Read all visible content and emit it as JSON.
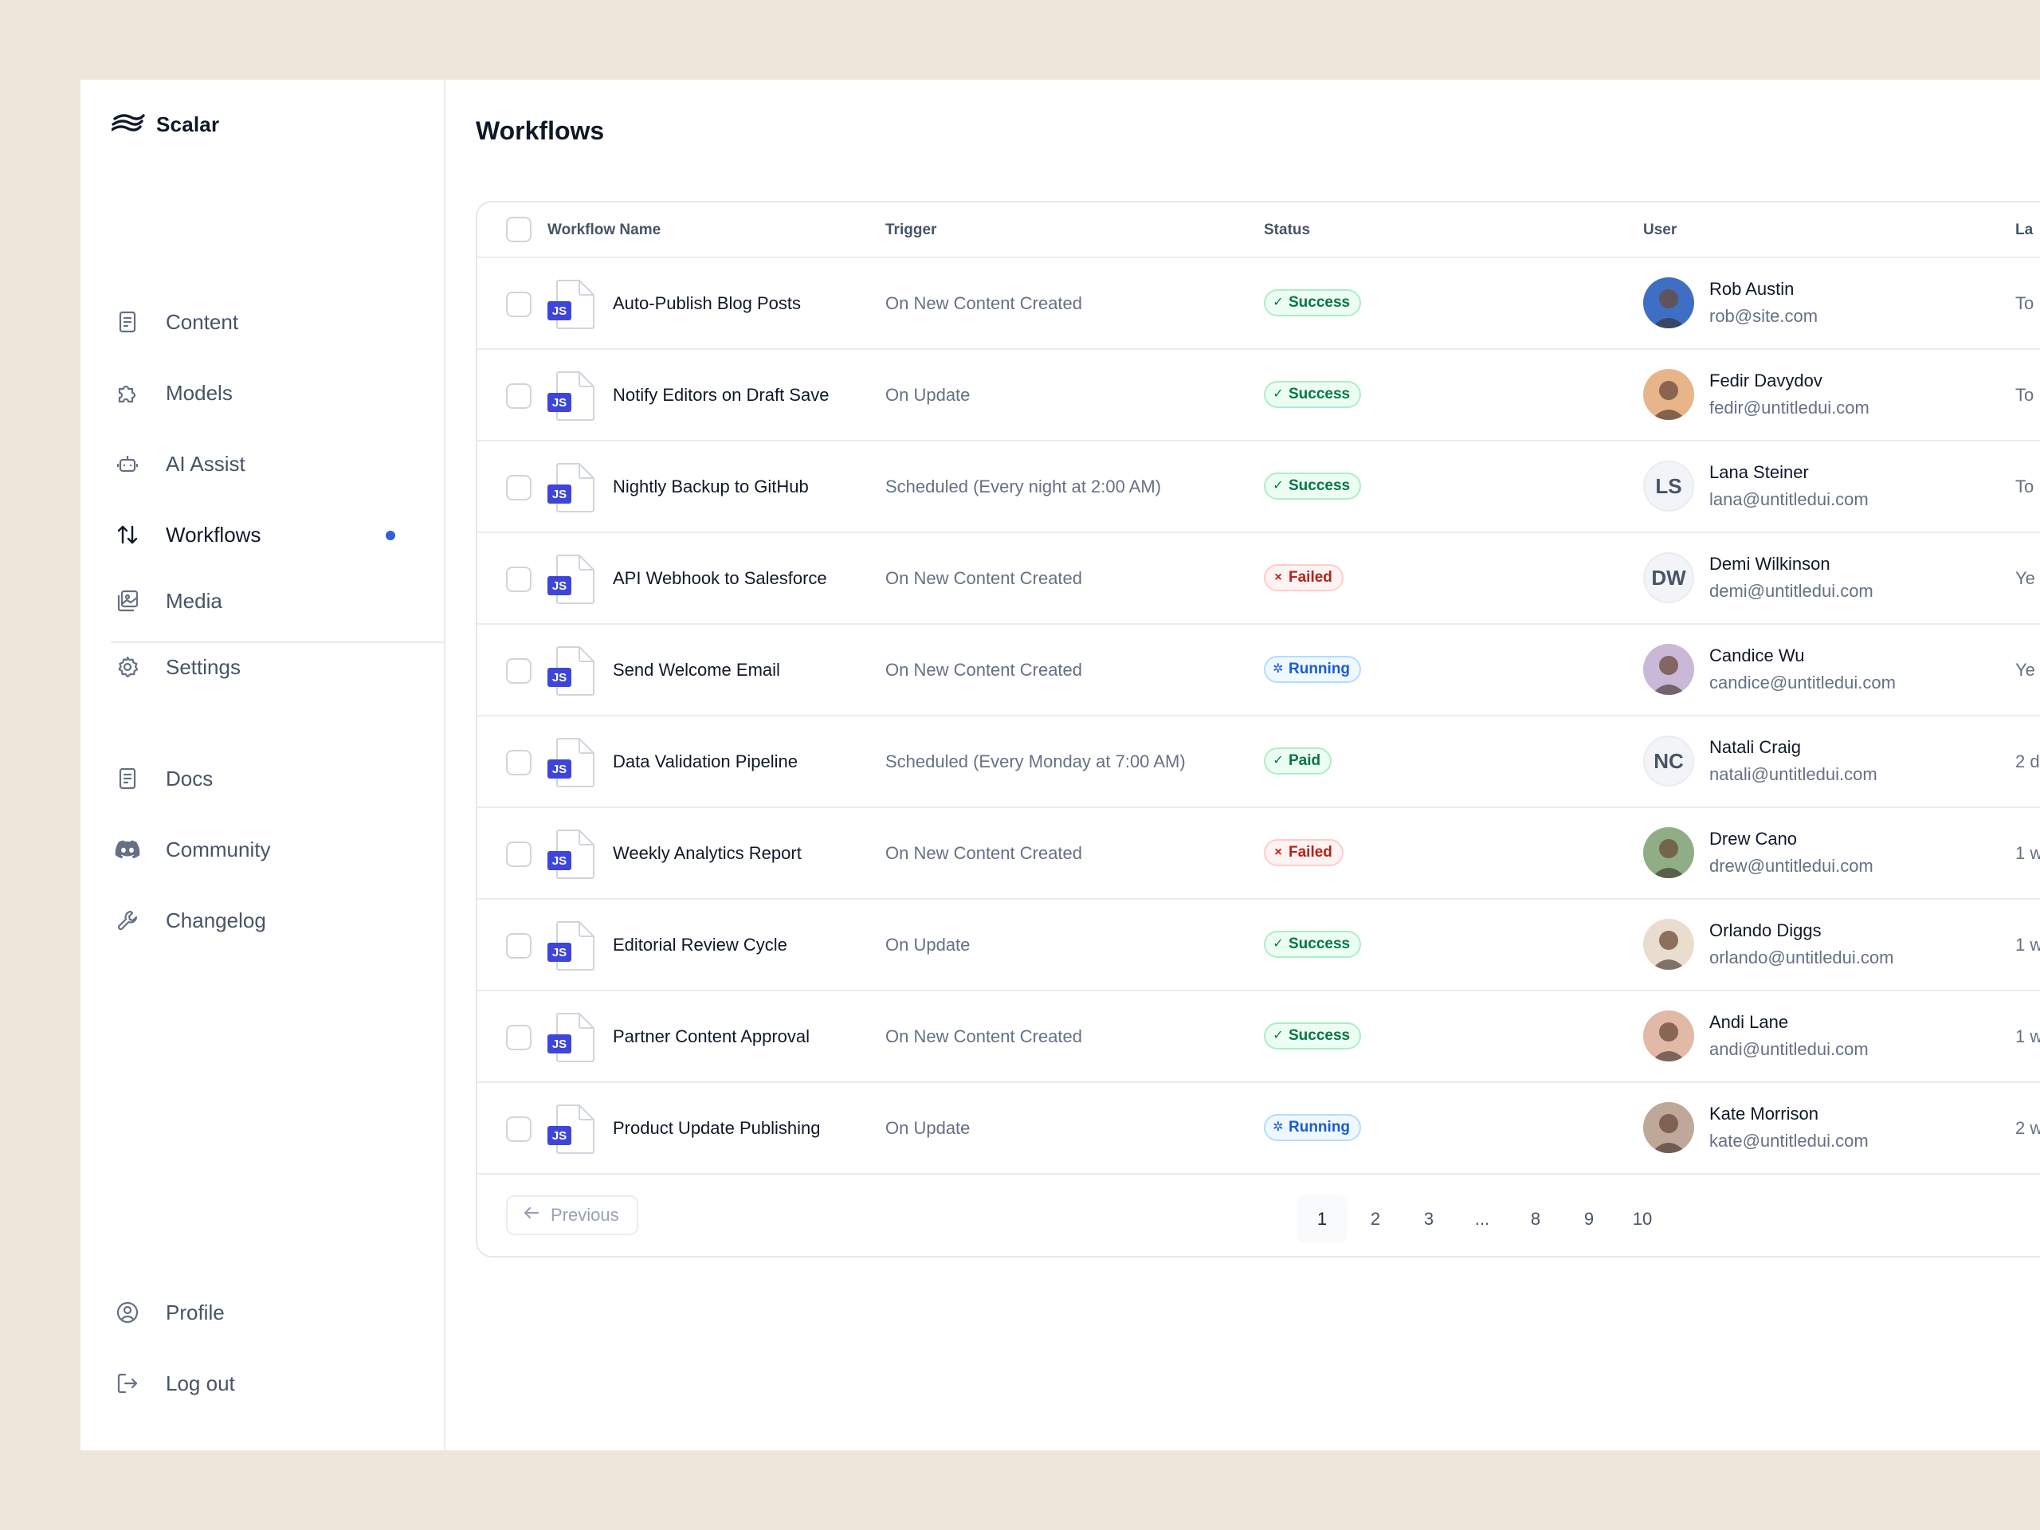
{
  "app": {
    "name": "Scalar"
  },
  "sidebar": {
    "items": [
      {
        "label": "Content",
        "icon": "document-icon"
      },
      {
        "label": "Models",
        "icon": "puzzle-icon"
      },
      {
        "label": "AI Assist",
        "icon": "robot-icon"
      },
      {
        "label": "Workflows",
        "icon": "arrows-up-down-icon",
        "active": true
      },
      {
        "label": "Media",
        "icon": "image-stack-icon"
      },
      {
        "label": "Settings",
        "icon": "gear-icon"
      }
    ],
    "secondary": [
      {
        "label": "Docs",
        "icon": "document-icon"
      },
      {
        "label": "Community",
        "icon": "discord-icon"
      },
      {
        "label": "Changelog",
        "icon": "wrench-icon"
      }
    ],
    "footer": [
      {
        "label": "Profile",
        "icon": "user-circle-icon"
      },
      {
        "label": "Log out",
        "icon": "log-out-icon"
      }
    ]
  },
  "main": {
    "title": "Workflows",
    "columns": [
      "Workflow Name",
      "Trigger",
      "Status",
      "User",
      "La"
    ],
    "file_badge": "JS",
    "rows": [
      {
        "name": "Auto-Publish Blog Posts",
        "trigger": "On New Content Created",
        "status": "Success",
        "status_type": "success",
        "user": "Rob Austin",
        "email": "rob@site.com",
        "avatar": "photo",
        "avatar_color": "#3e6fc4",
        "last": "To"
      },
      {
        "name": "Notify Editors on Draft Save",
        "trigger": "On Update",
        "status": "Success",
        "status_type": "success",
        "user": "Fedir Davydov",
        "email": "fedir@untitledui.com",
        "avatar": "photo",
        "avatar_color": "#e8b48a",
        "last": "To"
      },
      {
        "name": "Nightly Backup to GitHub",
        "trigger": "Scheduled (Every night at 2:00 AM)",
        "status": "Success",
        "status_type": "success",
        "user": "Lana Steiner",
        "email": "lana@untitledui.com",
        "avatar": "LS",
        "last": "To"
      },
      {
        "name": "API Webhook to Salesforce",
        "trigger": "On New Content Created",
        "status": "Failed",
        "status_type": "failed",
        "user": "Demi Wilkinson",
        "email": "demi@untitledui.com",
        "avatar": "DW",
        "last": "Ye"
      },
      {
        "name": "Send Welcome Email",
        "trigger": "On New Content Created",
        "status": "Running",
        "status_type": "running",
        "user": "Candice Wu",
        "email": "candice@untitledui.com",
        "avatar": "photo",
        "avatar_color": "#c9b8d8",
        "last": "Ye"
      },
      {
        "name": "Data Validation Pipeline",
        "trigger": "Scheduled (Every Monday at 7:00 AM)",
        "status": "Paid",
        "status_type": "paid",
        "user": "Natali Craig",
        "email": "natali@untitledui.com",
        "avatar": "NC",
        "last": "2 d"
      },
      {
        "name": "Weekly Analytics Report",
        "trigger": "On New Content Created",
        "status": "Failed",
        "status_type": "failed",
        "user": "Drew Cano",
        "email": "drew@untitledui.com",
        "avatar": "photo",
        "avatar_color": "#8fae86",
        "last": "1 w"
      },
      {
        "name": "Editorial Review Cycle",
        "trigger": "On Update",
        "status": "Success",
        "status_type": "success",
        "user": "Orlando Diggs",
        "email": "orlando@untitledui.com",
        "avatar": "photo",
        "avatar_color": "#e9ddd0",
        "last": "1 w"
      },
      {
        "name": "Partner Content Approval",
        "trigger": "On New Content Created",
        "status": "Success",
        "status_type": "success",
        "user": "Andi Lane",
        "email": "andi@untitledui.com",
        "avatar": "photo",
        "avatar_color": "#e2b9a6",
        "last": "1 w"
      },
      {
        "name": "Product Update Publishing",
        "trigger": "On Update",
        "status": "Running",
        "status_type": "running",
        "user": "Kate Morrison",
        "email": "kate@untitledui.com",
        "avatar": "photo",
        "avatar_color": "#bfa89a",
        "last": "2 w"
      }
    ],
    "pagination": {
      "previous": "Previous",
      "pages": [
        "1",
        "2",
        "3",
        "...",
        "8",
        "9",
        "10"
      ],
      "current": "1"
    }
  },
  "colors": {
    "background": "#efe6da",
    "accent": "#2e60e0",
    "js_badge": "#3e45d9"
  }
}
